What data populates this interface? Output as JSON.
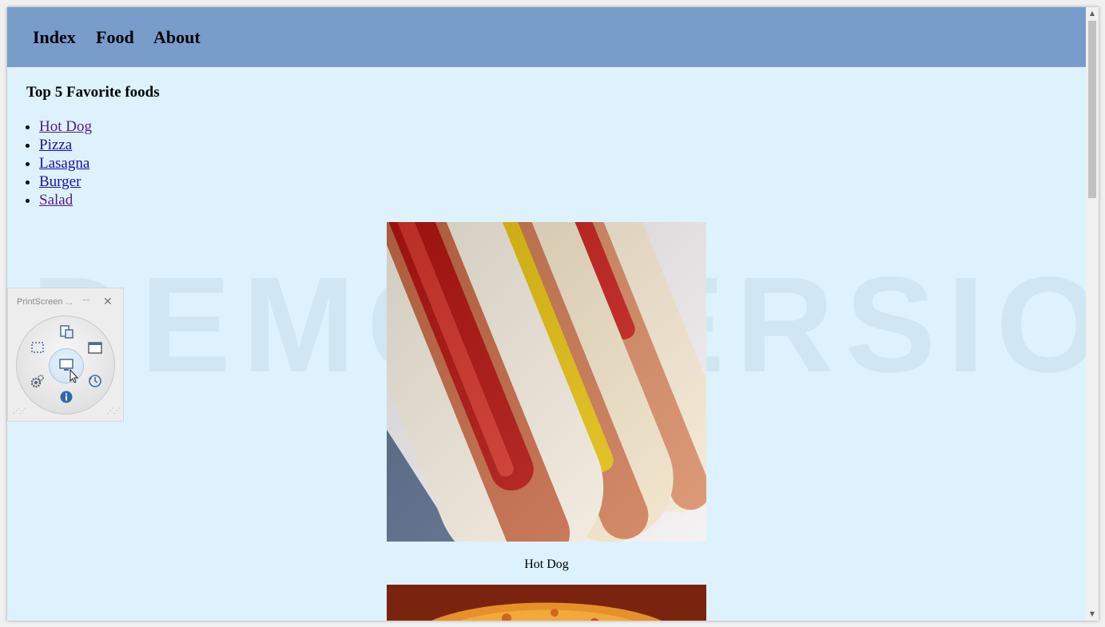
{
  "nav": {
    "items": [
      {
        "label": "Index"
      },
      {
        "label": "Food"
      },
      {
        "label": "About"
      }
    ]
  },
  "main": {
    "heading": "Top 5 Favorite foods",
    "foods": [
      {
        "label": "Hot Dog",
        "visited": true
      },
      {
        "label": "Pizza",
        "visited": false
      },
      {
        "label": "Lasagna",
        "visited": false
      },
      {
        "label": "Burger",
        "visited": false
      },
      {
        "label": "Salad",
        "visited": true
      }
    ],
    "image_caption": "Hot Dog"
  },
  "watermark": {
    "text": "DEMO VERSION"
  },
  "printscreen_widget": {
    "title": "PrintScreen ...",
    "close_glyph": "✕",
    "pin_glyph": "−▫"
  },
  "colors": {
    "navbar": "#789dcb",
    "page_background": "#ddf2fd",
    "link": "#1a0dab",
    "visited_link": "#551a8b"
  }
}
